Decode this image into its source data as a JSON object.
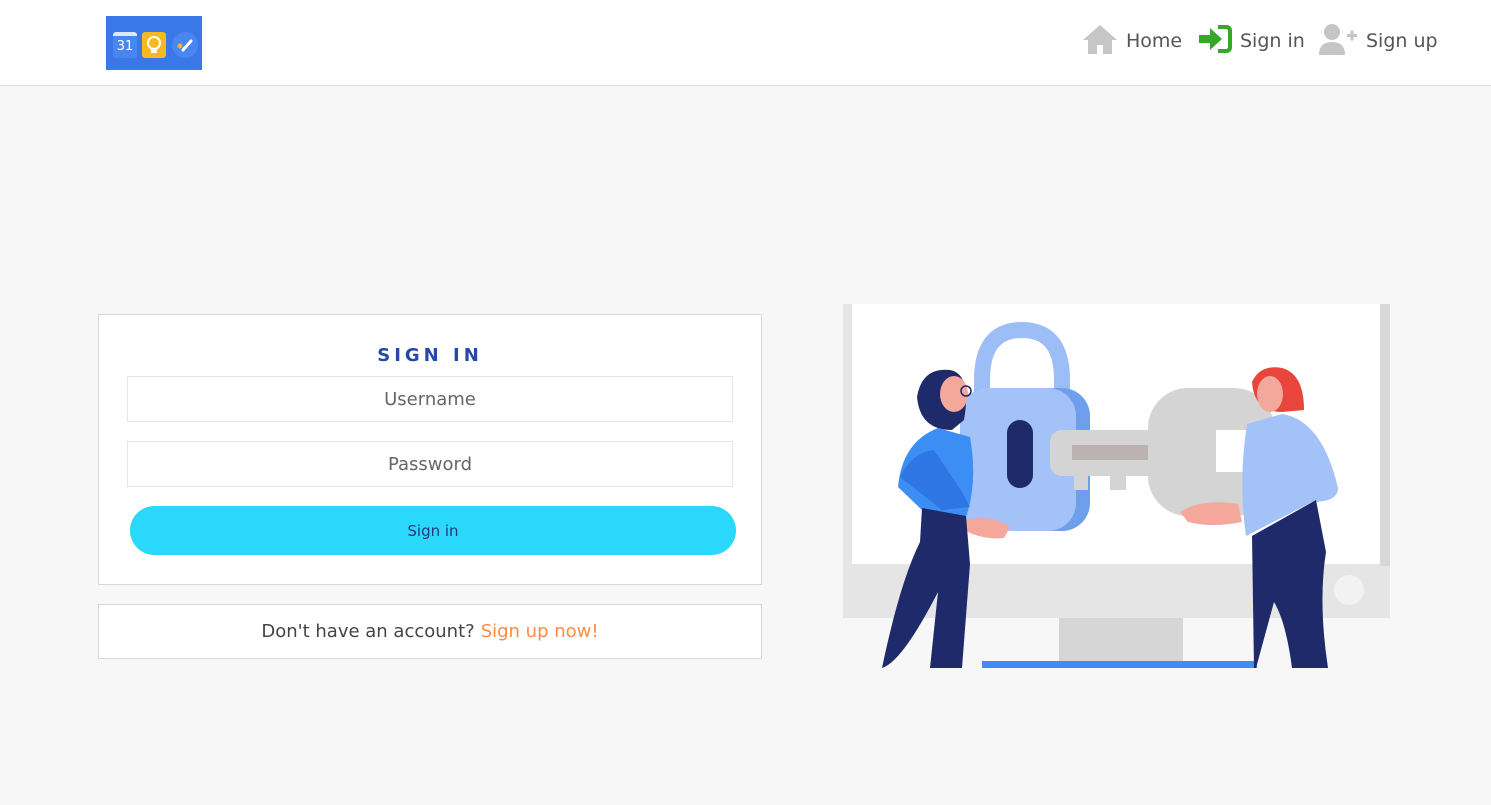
{
  "header": {
    "logo": {
      "calendar_day": "31",
      "icons": [
        "calendar-icon",
        "lightbulb-icon",
        "check-icon"
      ]
    },
    "nav": [
      {
        "label": "Home",
        "icon": "home-icon",
        "color": "#c6c6c6"
      },
      {
        "label": "Sign in",
        "icon": "sign-in-icon",
        "color": "#35a829"
      },
      {
        "label": "Sign up",
        "icon": "user-plus-icon",
        "color": "#c6c6c6"
      }
    ]
  },
  "signin": {
    "title": "SIGN IN",
    "username_placeholder": "Username",
    "password_placeholder": "Password",
    "button_label": "Sign in"
  },
  "signup": {
    "prompt": "Don't have an account?",
    "link": "Sign up now!"
  },
  "colors": {
    "accent": "#2ad8fc",
    "title": "#2748a8",
    "link": "#ff8c42",
    "brand": "#3b78e7"
  }
}
